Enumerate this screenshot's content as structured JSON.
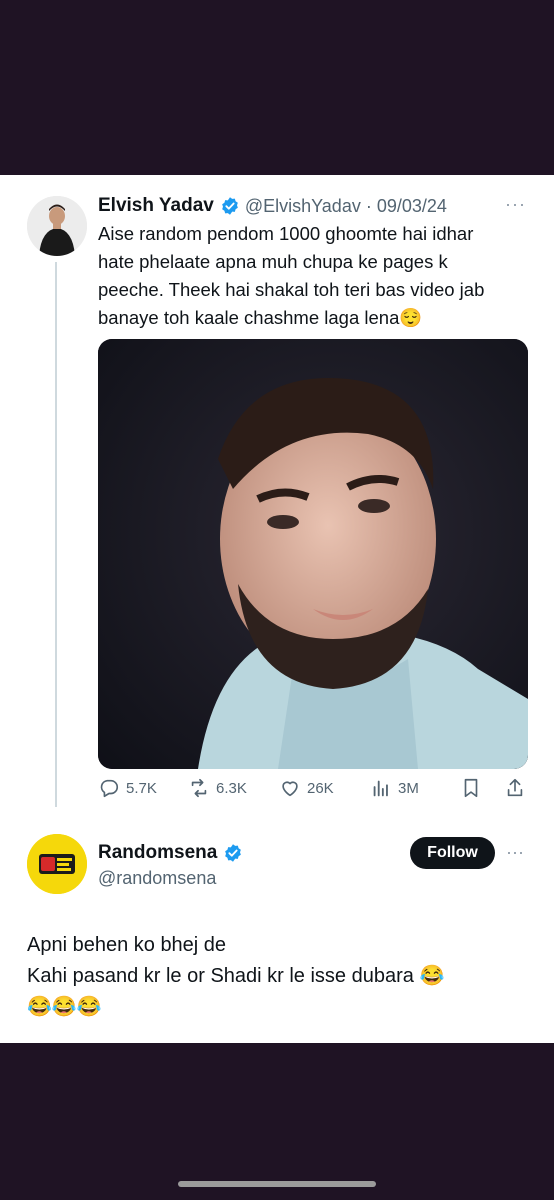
{
  "tweet": {
    "author_name": "Elvish Yadav",
    "handle_date": "@ElvishYadav · 09/03/24",
    "more": "···",
    "lines": [
      "Aise random pendom 1000 ghoomte hai idhar",
      "hate phelaate apna muh chupa ke pages k",
      "peeche. Theek hai shakal toh teri bas video jab",
      "banaye toh kaale chashme laga lena😌"
    ],
    "stats": {
      "replies": "5.7K",
      "retweets": "6.3K",
      "likes": "26K",
      "views": "3M"
    }
  },
  "reply": {
    "author_name": "Randomsena",
    "handle": "@randomsena",
    "follow_label": "Follow",
    "more": "···",
    "lines": [
      "Apni behen ko bhej de",
      "Kahi pasand kr le or Shadi kr le isse dubara 😂",
      "😂😂😂"
    ]
  },
  "colors": {
    "background": "#1f1324",
    "card": "#ffffff",
    "verified": "#1d9bf0",
    "secondary_text": "#536471",
    "follow_button": "#0f1419",
    "randomsena_avatar": "#f5d80b"
  }
}
